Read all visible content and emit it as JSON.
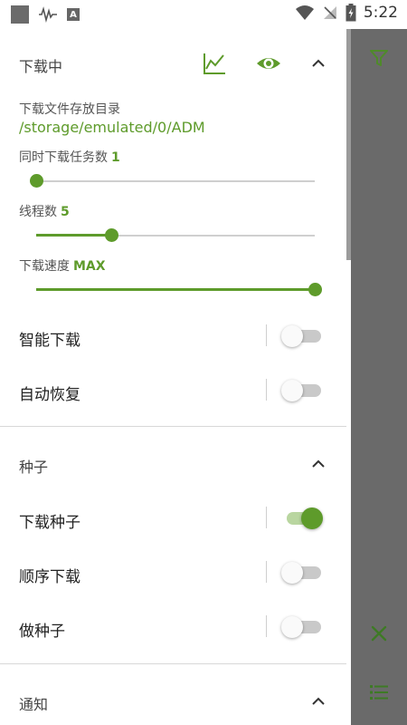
{
  "status_bar": {
    "time": "5:22",
    "keyboard_badge": "A"
  },
  "colors": {
    "accent": "#5e9b2b",
    "rail": "#6a6a6a"
  },
  "downloading": {
    "title": "下载中",
    "dir_label": "下载文件存放目录",
    "dir_path": "/storage/emulated/0/ADM",
    "concurrent": {
      "label": "同时下载任务数",
      "value": "1",
      "fraction": 0.0
    },
    "threads": {
      "label": "线程数",
      "value": "5",
      "fraction": 0.27
    },
    "speed": {
      "label": "下载速度",
      "value": "MAX",
      "fraction": 1.0
    },
    "smart_download": {
      "label": "智能下载",
      "on": false
    },
    "auto_resume": {
      "label": "自动恢复",
      "on": false
    }
  },
  "torrent": {
    "title": "种子",
    "download_torrent": {
      "label": "下载种子",
      "on": true
    },
    "sequential": {
      "label": "顺序下载",
      "on": false
    },
    "seed": {
      "label": "做种子",
      "on": false
    }
  },
  "notification": {
    "title": "通知"
  },
  "icons": [
    "chart-icon",
    "eye-icon",
    "chevron-up-icon",
    "filter-icon",
    "close-icon",
    "list-icon"
  ]
}
